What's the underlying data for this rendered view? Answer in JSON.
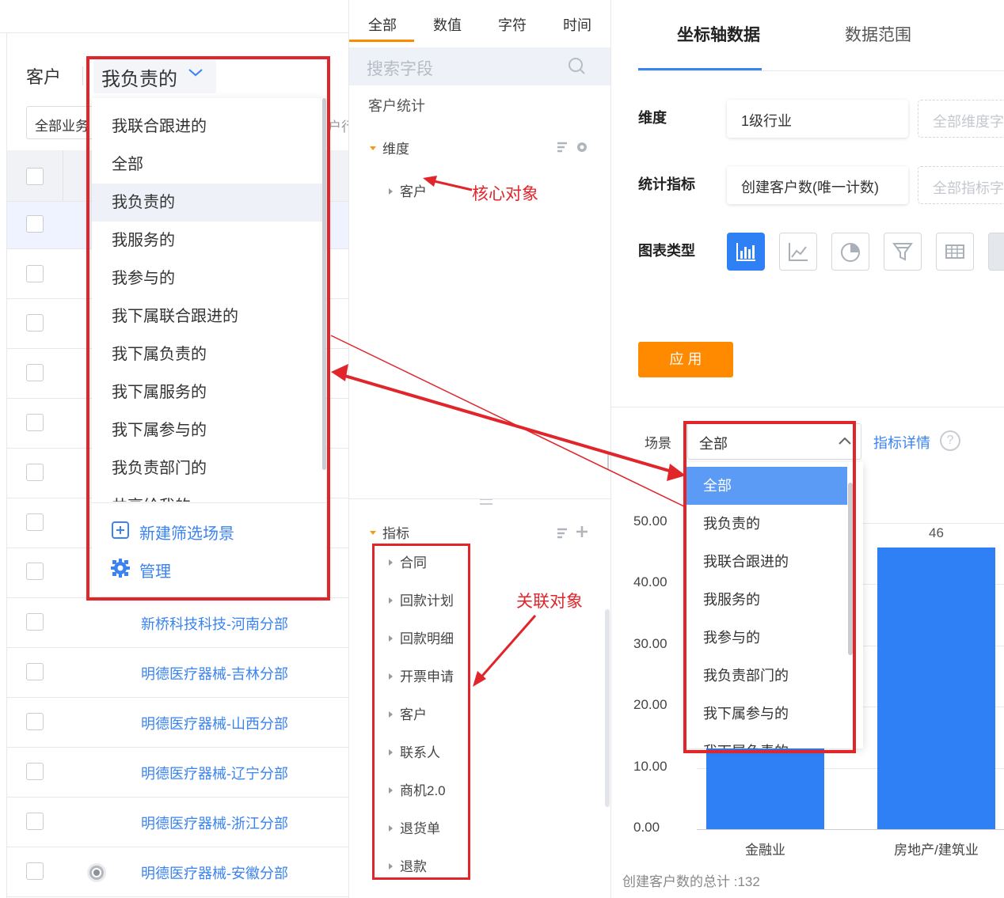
{
  "left": {
    "title": "客户",
    "filter_select": "我负责的",
    "biz_filter": "全部业务",
    "col_hint": "户行",
    "dropdown_items": [
      "我联合跟进的",
      "全部",
      "我负责的",
      "我服务的",
      "我参与的",
      "我下属联合跟进的",
      "我下属负责的",
      "我下属服务的",
      "我下属参与的",
      "我负责部门的",
      "共享给我的"
    ],
    "new_scene": "新建筛选场景",
    "manage": "管理",
    "rows": [
      "新桥科技科技-河南分部",
      "明德医疗器械-吉林分部",
      "明德医疗器械-山西分部",
      "明德医疗器械-辽宁分部",
      "明德医疗器械-浙江分部",
      "明德医疗器械-安徽分部"
    ]
  },
  "middle": {
    "tabs": [
      "全部",
      "数值",
      "字符",
      "时间"
    ],
    "search_placeholder": "搜索字段",
    "group_title": "客户统计",
    "dimension": "维度",
    "dimension_item": "客户",
    "annotation_core": "核心对象",
    "metric": "指标",
    "metric_items": [
      "合同",
      "回款计划",
      "回款明细",
      "开票申请",
      "客户",
      "联系人",
      "商机2.0",
      "退货单",
      "退款"
    ],
    "annotation_related": "关联对象"
  },
  "right": {
    "tabs": [
      "坐标轴数据",
      "数据范围"
    ],
    "dim_label": "维度",
    "dim_value": "1级行业",
    "dim_placeholder": "全部维度字",
    "metric_label": "统计指标",
    "metric_value": "创建客户数(唯一计数)",
    "metric_placeholder": "全部指标字",
    "chart_type_label": "图表类型",
    "apply": "应 用",
    "scene_label": "场景",
    "scene_value": "全部",
    "metric_detail": "指标详情",
    "help_icon_char": "?",
    "scene_options": [
      "全部",
      "我负责的",
      "我联合跟进的",
      "我服务的",
      "我参与的",
      "我负责部门的",
      "我下属参与的",
      "我下属负责的"
    ],
    "total": "创建客户数的总计 :132"
  },
  "chart_data": {
    "type": "bar",
    "categories": [
      "金融业",
      "房地产/建筑业"
    ],
    "values": [
      null,
      46
    ],
    "data_labels": [
      "",
      "46"
    ],
    "ylim": [
      0,
      50
    ],
    "y_ticks": [
      "0.00",
      "10.00",
      "20.00",
      "30.00",
      "40.00",
      "50.00"
    ],
    "title": "",
    "xlabel": "",
    "ylabel": "",
    "grid": true,
    "color": "#2f80f5"
  },
  "colors": {
    "accent": "#2f80f5",
    "link": "#3a83f0",
    "orange": "#ff8a00",
    "annot": "#e0252b"
  }
}
